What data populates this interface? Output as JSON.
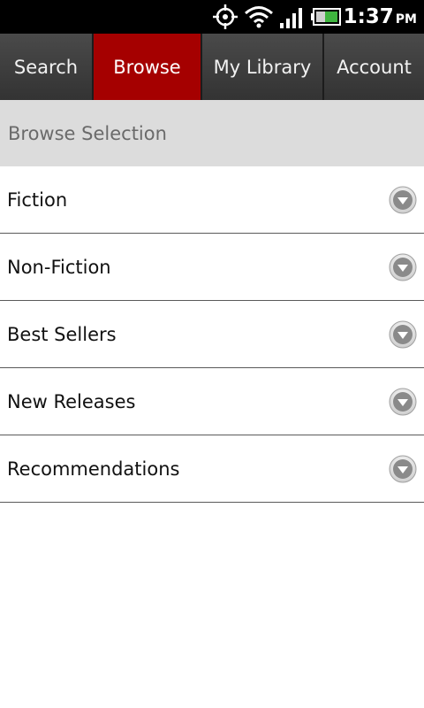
{
  "status_bar": {
    "time": "1:37",
    "ampm": "PM",
    "icons": [
      "gps-icon",
      "wifi-icon",
      "signal-icon",
      "battery-icon"
    ]
  },
  "tabs": [
    {
      "label": "Search",
      "active": false
    },
    {
      "label": "Browse",
      "active": true
    },
    {
      "label": "My Library",
      "active": false
    },
    {
      "label": "Account",
      "active": false
    }
  ],
  "section": {
    "title": "Browse Selection"
  },
  "list": {
    "items": [
      {
        "label": "Fiction"
      },
      {
        "label": "Non-Fiction"
      },
      {
        "label": "Best Sellers"
      },
      {
        "label": "New Releases"
      },
      {
        "label": "Recommendations"
      }
    ],
    "expand_icon": "chevron-down-icon"
  },
  "colors": {
    "active_tab": "#a50000",
    "tab_bg": "#3b3b3b",
    "section_bg": "#dcdcdc",
    "status_bar_bg": "#000000"
  }
}
